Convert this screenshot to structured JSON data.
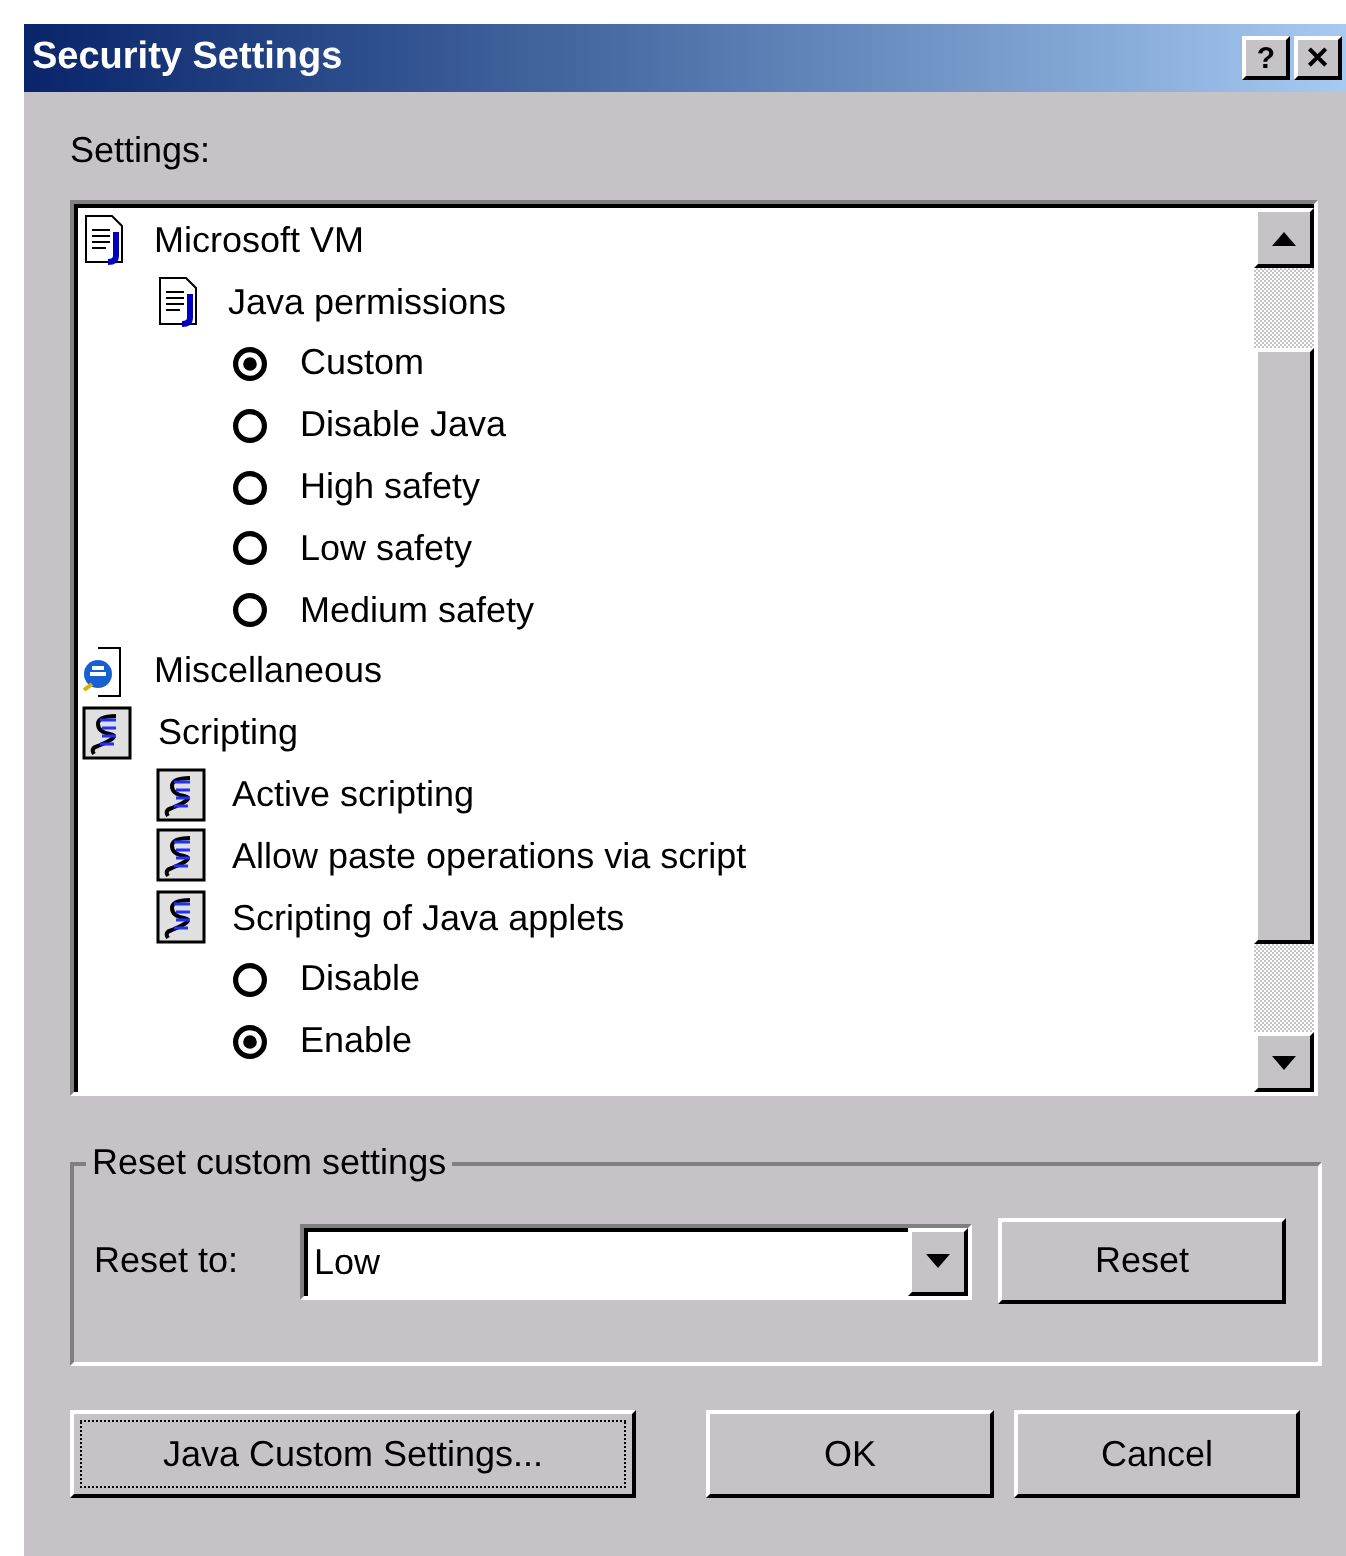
{
  "window": {
    "title": "Security Settings",
    "buttons": [
      "?",
      "✕"
    ]
  },
  "settings_label": "Settings:",
  "tree": [
    {
      "kind": "java-node",
      "label": "Microsoft VM",
      "children": [
        {
          "kind": "java-node",
          "label": "Java permissions",
          "children": [
            {
              "kind": "radio",
              "label": "Custom",
              "selected": true
            },
            {
              "kind": "radio",
              "label": "Disable Java",
              "selected": false
            },
            {
              "kind": "radio",
              "label": "High safety",
              "selected": false
            },
            {
              "kind": "radio",
              "label": "Low safety",
              "selected": false
            },
            {
              "kind": "radio",
              "label": "Medium safety",
              "selected": false
            }
          ]
        }
      ]
    },
    {
      "kind": "ie-node",
      "label": "Miscellaneous"
    },
    {
      "kind": "script-node",
      "label": "Scripting",
      "children": [
        {
          "kind": "script-node",
          "label": "Active scripting"
        },
        {
          "kind": "script-node",
          "label": "Allow paste operations via script"
        },
        {
          "kind": "script-node",
          "label": "Scripting of Java applets",
          "children": [
            {
              "kind": "radio",
              "label": "Disable",
              "selected": false
            },
            {
              "kind": "radio",
              "label": "Enable",
              "selected": true
            }
          ]
        }
      ]
    }
  ],
  "reset_group": {
    "title": "Reset custom settings",
    "label": "Reset to:",
    "value": "Low",
    "button": "Reset"
  },
  "buttons": [
    "Java Custom Settings...",
    "OK",
    "Cancel"
  ]
}
